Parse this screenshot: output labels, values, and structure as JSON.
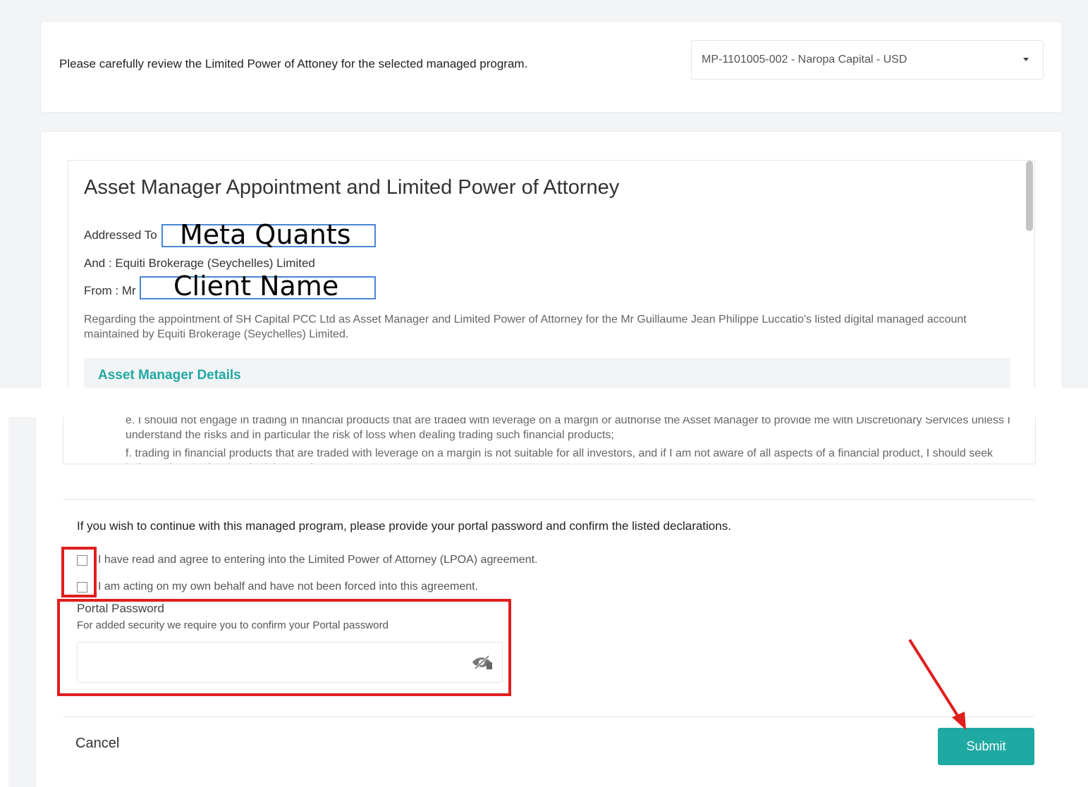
{
  "header": {
    "instruction": "Please carefully review the Limited Power of Attoney for the selected managed program.",
    "program_select": {
      "value": "MP-1101005-002 - Naropa Capital - USD"
    }
  },
  "document": {
    "title": "Asset Manager Appointment and Limited Power of Attorney",
    "addressed_to_label": "Addressed To",
    "addressed_to_value": "Meta Quants",
    "and_line": "And : Equiti Brokerage (Seychelles) Limited",
    "from_label": "From : Mr",
    "from_value": "Client Name",
    "regarding": "Regarding the appointment of SH Capital PCC Ltd as Asset Manager and Limited Power of Attorney for the Mr Guillaume Jean Philippe Luccatio's listed digital managed account maintained by Equiti Brokerage (Seychelles) Limited.",
    "section_title": "Asset Manager Details",
    "item_e": "e. I should not engage in trading in financial products that are traded with leverage on a margin or authorise the Asset Manager to provide me with Discretionary Services unless I understand the risks and in particular the risk of loss when dealing trading such financial products;",
    "item_f": "f. trading in financial products that are traded with leverage on a margin is not suitable for all investors, and if I am not aware of all aspects of a financial product, I should seek independent professional advice; and"
  },
  "confirmation": {
    "instruction": "If you wish to continue with this managed program, please provide your portal password and confirm the listed declarations.",
    "checkbox_1": {
      "label": "I have read and agree to entering into the Limited Power of Attorney (LPOA) agreement.",
      "checked": false
    },
    "checkbox_2": {
      "label": "I am acting on my own behalf and have not been forced into this agreement.",
      "checked": false
    },
    "password_label": "Portal Password",
    "password_help": "For added security we require you to confirm your Portal password",
    "password_value": ""
  },
  "actions": {
    "cancel_label": "Cancel",
    "submit_label": "Submit"
  },
  "colors": {
    "accent": "#1fa9a3",
    "annotation_red": "#e01e1e",
    "annotation_blue": "#4a86d4"
  },
  "icons": [
    "chevron-down-icon",
    "eye-slash-icon",
    "annotation-arrow"
  ]
}
